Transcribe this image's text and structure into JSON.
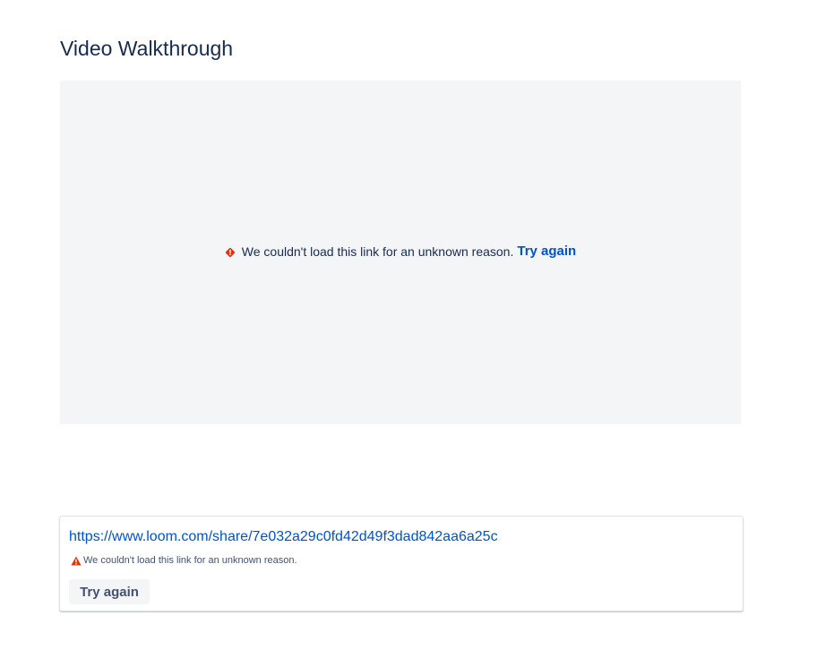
{
  "page": {
    "title": "Video Walkthrough"
  },
  "embed": {
    "error_message": "We couldn't load this link for an unknown reason.",
    "retry_label": "Try again",
    "icon": "error-diamond-icon"
  },
  "link_card": {
    "url": "https://www.loom.com/share/7e032a29c0fd42d49f3dad842aa6a25c",
    "error_message": "We couldn't load this link for an unknown reason.",
    "retry_label": "Try again",
    "icon": "warning-icon"
  },
  "colors": {
    "link": "#0052cc",
    "error": "#de350b",
    "text": "#172b4d",
    "frame_bg": "#f4f5f7"
  }
}
